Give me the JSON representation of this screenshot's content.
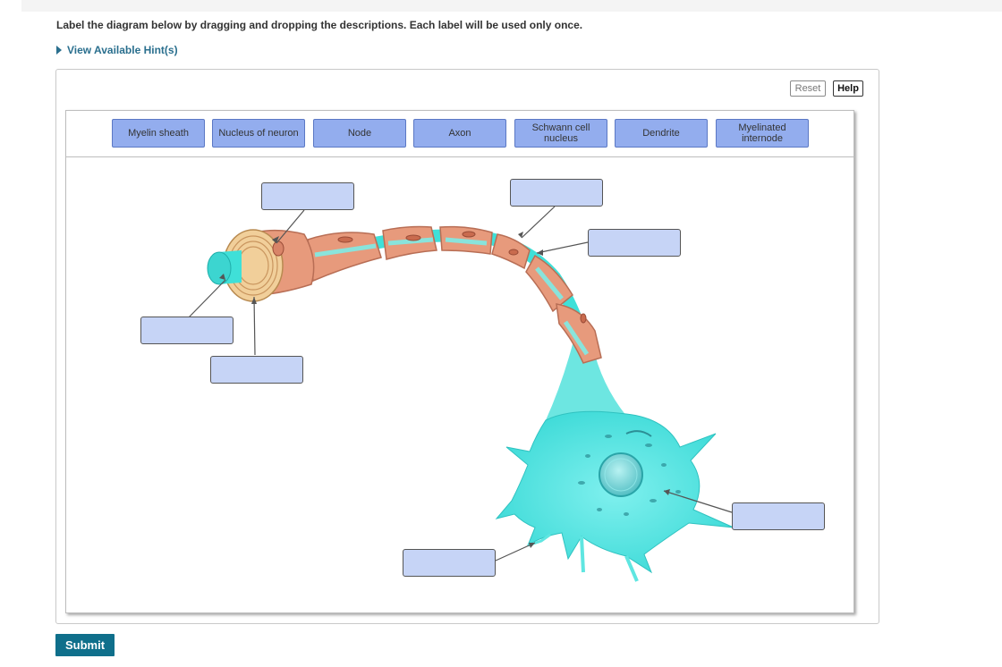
{
  "instructions": "Label the diagram below by dragging and dropping the descriptions. Each label will be used only once.",
  "hint_link": "View Available Hint(s)",
  "toolbar": {
    "reset": "Reset",
    "help": "Help"
  },
  "label_bank": [
    "Myelin sheath",
    "Nucleus of neuron",
    "Node",
    "Axon",
    "Schwann cell nucleus",
    "Dendrite",
    "Myelinated internode"
  ],
  "submit": "Submit",
  "colors": {
    "chip": "#93adee",
    "target": "#c6d4f6",
    "submit": "#0f6f8b",
    "link": "#2a6f8e",
    "axon": "#3fe0d8",
    "myelin": "#e79a7c"
  }
}
